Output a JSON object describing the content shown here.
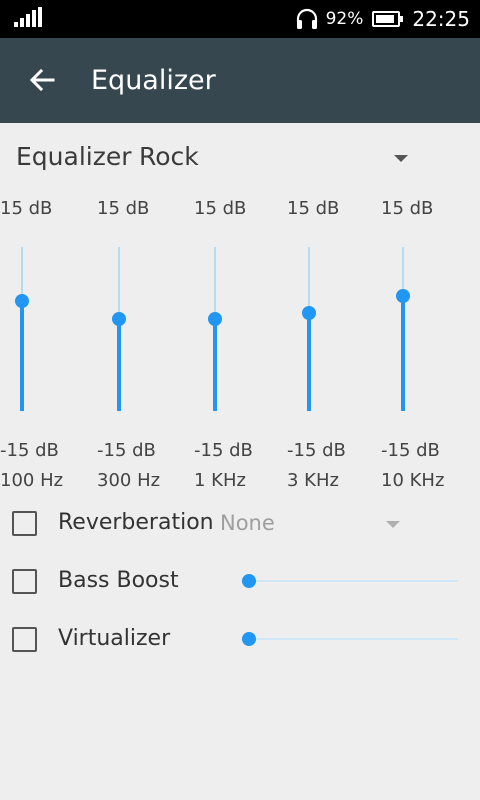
{
  "status_bar": {
    "battery_percent": "92%",
    "battery_level": 0.92,
    "time": "22:25",
    "icons": [
      "signal-icon",
      "headset-icon",
      "battery-icon"
    ]
  },
  "app_bar": {
    "title": "Equalizer",
    "back_icon": "arrow-back-icon"
  },
  "preset": {
    "label": "Equalizer",
    "value": "Rock"
  },
  "bands": [
    {
      "max": "15 dB",
      "min": "-15 dB",
      "freq": "100 Hz",
      "level": 0.67
    },
    {
      "max": "15 dB",
      "min": "-15 dB",
      "freq": "300 Hz",
      "level": 0.56
    },
    {
      "max": "15 dB",
      "min": "-15 dB",
      "freq": "1 KHz",
      "level": 0.56
    },
    {
      "max": "15 dB",
      "min": "-15 dB",
      "freq": "3 KHz",
      "level": 0.6
    },
    {
      "max": "15 dB",
      "min": "-15 dB",
      "freq": "10 KHz",
      "level": 0.7
    }
  ],
  "effects": {
    "reverberation": {
      "label": "Reverberation",
      "value": "None",
      "checked": false
    },
    "bass_boost": {
      "label": "Bass Boost",
      "checked": false,
      "level": 0
    },
    "virtualizer": {
      "label": "Virtualizer",
      "checked": false,
      "level": 0
    }
  },
  "colors": {
    "accent": "#2196f3",
    "app_bar": "#37474f",
    "background": "#eeeeee"
  }
}
